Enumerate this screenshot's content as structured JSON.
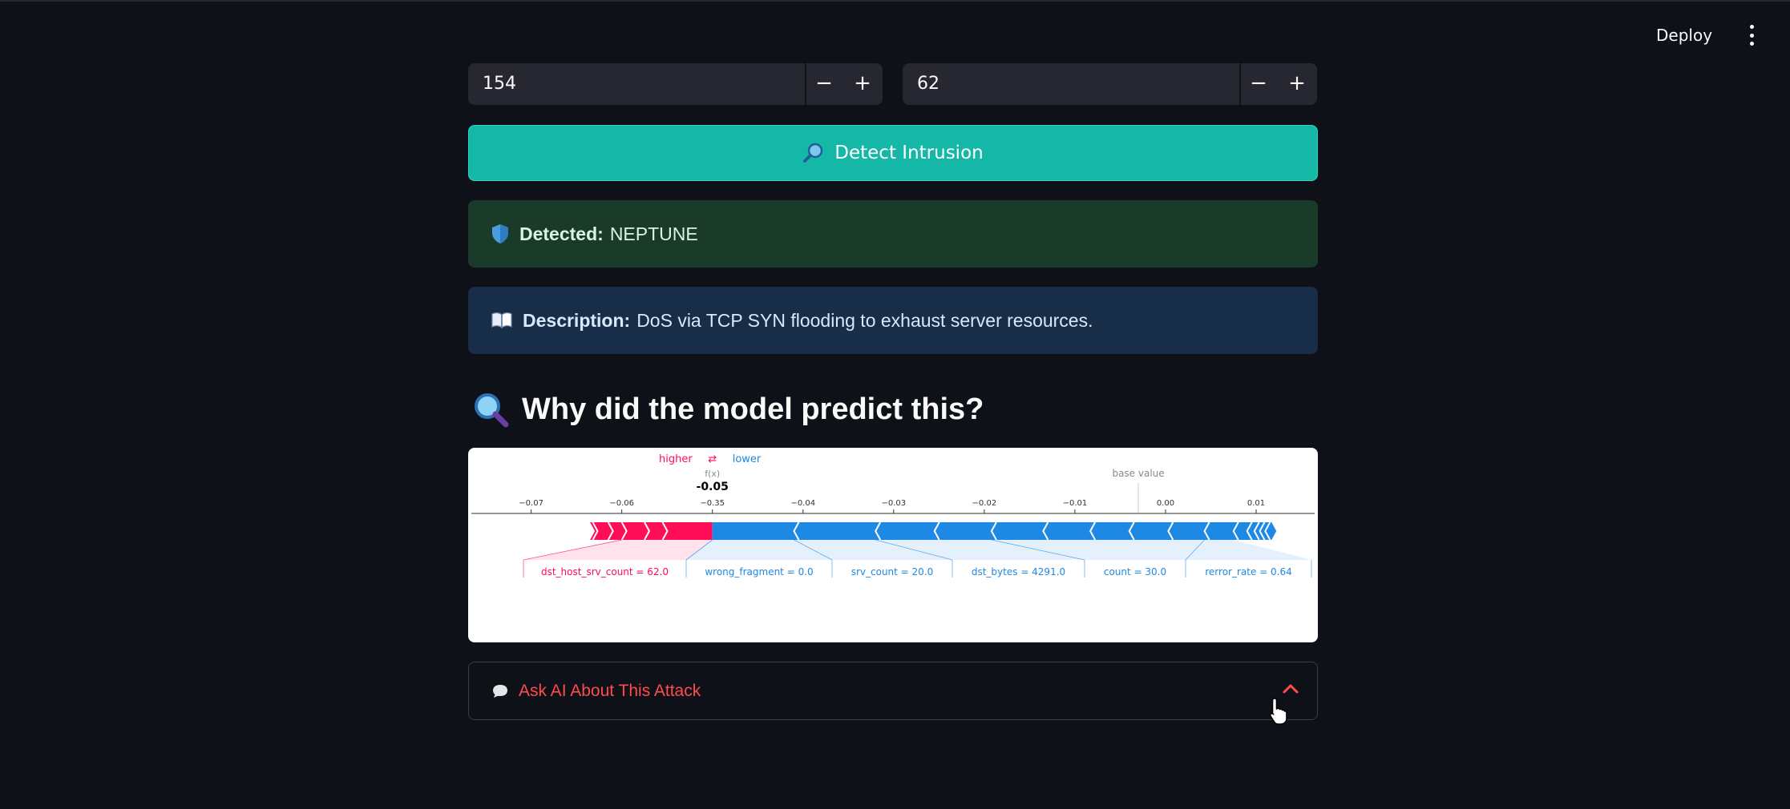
{
  "header": {
    "deploy_label": "Deploy",
    "menu_icon": "kebab-menu-icon"
  },
  "inputs": [
    {
      "value": "154",
      "minus": "−",
      "plus": "+"
    },
    {
      "value": "62",
      "minus": "−",
      "plus": "+"
    }
  ],
  "detect_button": {
    "icon": "magnifier-icon",
    "label": "Detect Intrusion"
  },
  "result": {
    "icon": "shield-icon",
    "label": "Detected:",
    "value": "NEPTUNE"
  },
  "description": {
    "icon": "book-icon",
    "label": "Description:",
    "value": "DoS via TCP SYN flooding to exhaust server resources."
  },
  "explain": {
    "icon": "magnifier-icon",
    "title": "Why did the model predict this?"
  },
  "chart_data": {
    "type": "shap-force",
    "legend_higher": "higher",
    "legend_lower": "lower",
    "legend_arrow": "⇄",
    "fx_label": "f(x)",
    "fx_value": -0.05,
    "fx_text": "-0.05",
    "base_value_label": "base value",
    "base_value": -0.003,
    "xlim": [
      -0.072,
      0.023
    ],
    "ticks": [
      {
        "v": -0.07,
        "label": "−0.07"
      },
      {
        "v": -0.06,
        "label": "−0.06"
      },
      {
        "v": -0.05,
        "label": "−0.35"
      },
      {
        "v": -0.04,
        "label": "−0.04"
      },
      {
        "v": -0.03,
        "label": "−0.03"
      },
      {
        "v": -0.02,
        "label": "−0.02"
      },
      {
        "v": -0.01,
        "label": "−0.01"
      },
      {
        "v": 0.0,
        "label": "0.00"
      },
      {
        "v": 0.01,
        "label": "0.01"
      },
      {
        "v": 0.02,
        "label": "0.02"
      }
    ],
    "positive_range": [
      -0.0635,
      -0.05
    ],
    "negative_range": [
      -0.05,
      0.0117
    ],
    "pos_arrows": [
      -0.0632,
      -0.0615,
      -0.06,
      -0.0575,
      -0.0555
    ],
    "neg_arrows": [
      -0.041,
      -0.032,
      -0.0255,
      -0.0192,
      -0.0135,
      -0.0083,
      -0.004,
      0.0003,
      0.0043,
      0.0075,
      0.009,
      0.0098,
      0.0104,
      0.011
    ],
    "features": [
      {
        "label": "dst_host_srv_count = 62.0",
        "direction": "higher",
        "range": [
          -0.06,
          -0.05
        ]
      },
      {
        "label": "wrong_fragment = 0.0",
        "direction": "lower",
        "range": [
          -0.05,
          -0.041
        ]
      },
      {
        "label": "srv_count = 20.0",
        "direction": "lower",
        "range": [
          -0.041,
          -0.032
        ]
      },
      {
        "label": "dst_bytes = 4291.0",
        "direction": "lower",
        "range": [
          -0.032,
          -0.0192
        ]
      },
      {
        "label": "count = 30.0",
        "direction": "lower",
        "range": [
          -0.0192,
          0.0043
        ]
      },
      {
        "label": "rerror_rate = 0.64",
        "direction": "lower",
        "range": [
          0.0043,
          0.0075
        ]
      }
    ],
    "colors": {
      "higher": "#ff0d57",
      "lower": "#1e88e5",
      "axis": "#333333",
      "muted": "#888888"
    }
  },
  "ask_ai": {
    "icon": "speech-bubble-icon",
    "label": "Ask AI About This Attack",
    "chevron": "chevron-up-icon"
  }
}
